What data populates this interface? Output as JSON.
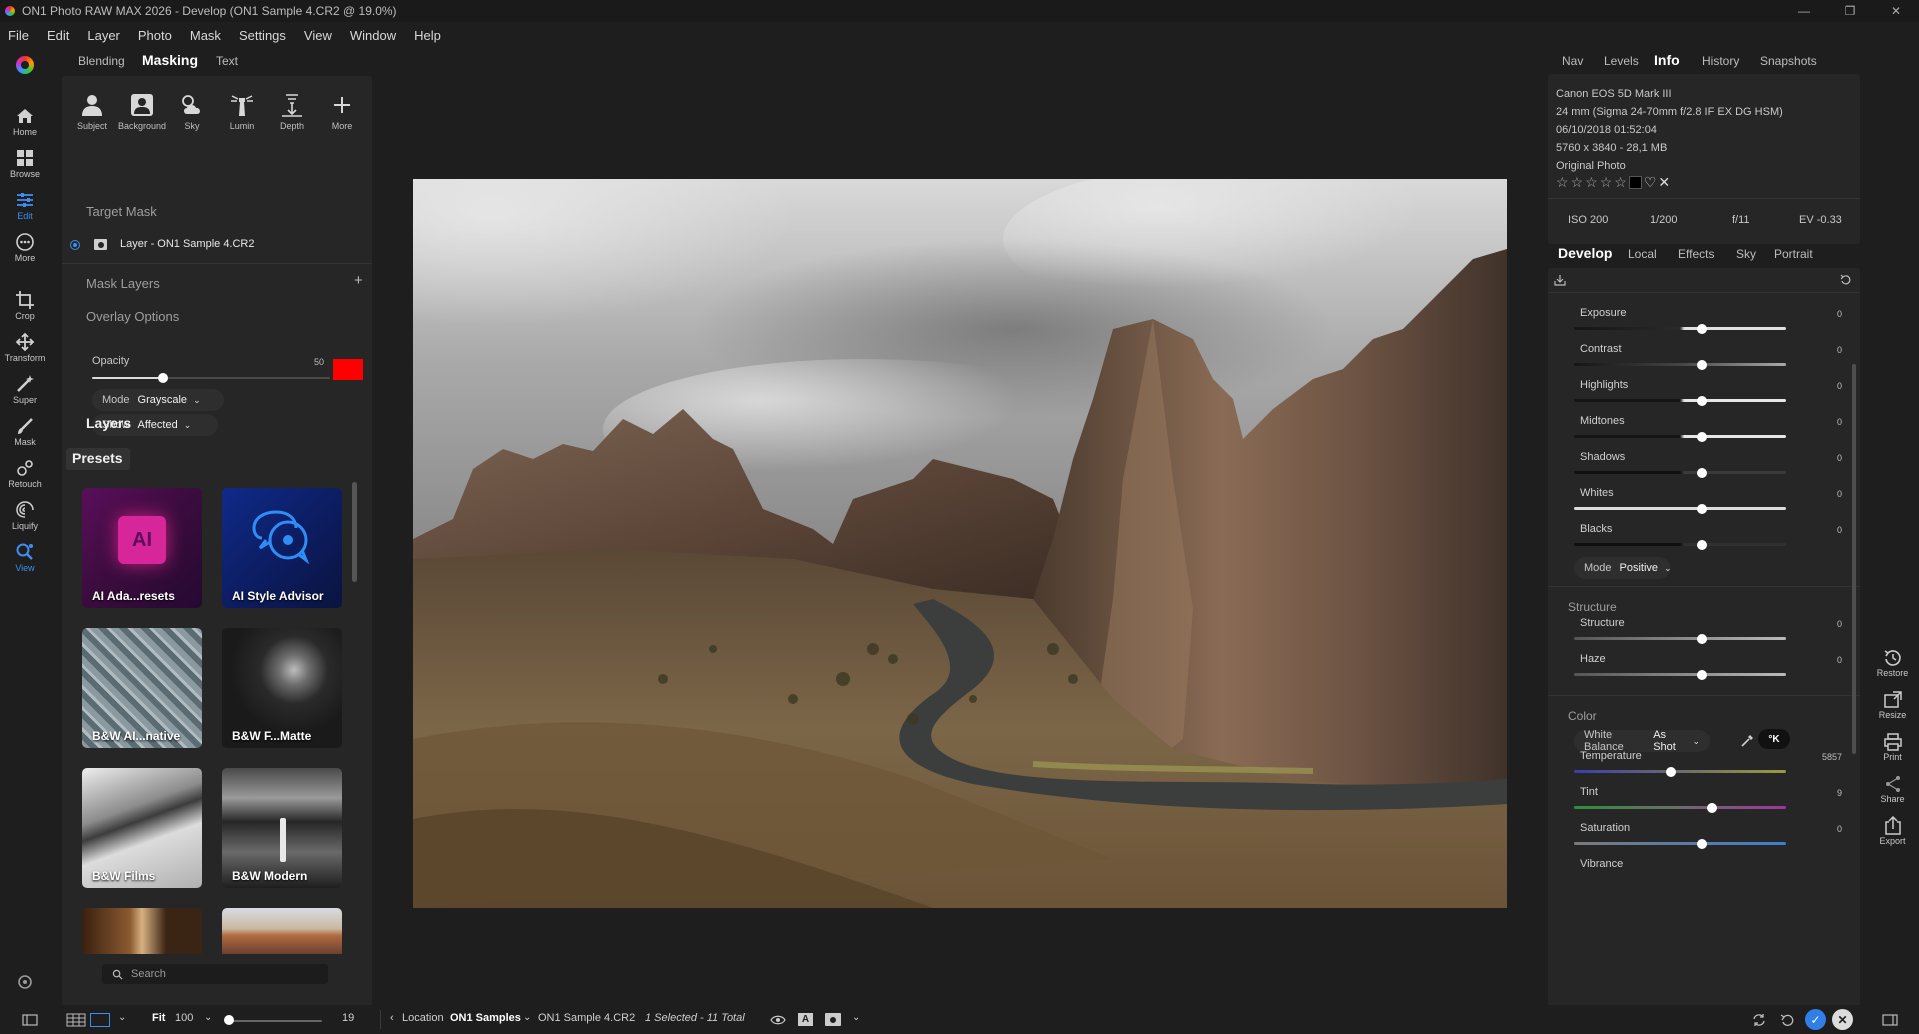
{
  "window": {
    "title": "ON1 Photo RAW MAX 2026 - Develop (ON1 Sample 4.CR2 @ 19.0%)",
    "controls": [
      "—",
      "❐",
      "✕"
    ]
  },
  "menu": [
    "File",
    "Edit",
    "Layer",
    "Photo",
    "Mask",
    "Settings",
    "View",
    "Window",
    "Help"
  ],
  "rail": [
    {
      "label": "Home",
      "icon": "home-icon"
    },
    {
      "label": "Browse",
      "icon": "grid-icon"
    },
    {
      "label": "Edit",
      "icon": "sliders-icon",
      "active": true
    },
    {
      "label": "More",
      "icon": "more-icon"
    },
    {
      "label": "Crop",
      "icon": "crop-icon"
    },
    {
      "label": "Transform",
      "icon": "move-icon"
    },
    {
      "label": "Super",
      "icon": "wand-icon"
    },
    {
      "label": "Mask",
      "icon": "brush-icon"
    },
    {
      "label": "Retouch",
      "icon": "retouch-icon"
    },
    {
      "label": "Liquify",
      "icon": "liquify-icon"
    },
    {
      "label": "View",
      "icon": "view-icon",
      "active": true
    }
  ],
  "leftpanel": {
    "tabs": [
      "Blending",
      "Masking",
      "Text"
    ],
    "active_tab": "Masking",
    "tools": [
      "Subject",
      "Background",
      "Sky",
      "Lumin",
      "Depth",
      "More"
    ],
    "target_mask_label": "Target Mask",
    "layer_name": "Layer - ON1 Sample 4.CR2",
    "mask_layers_label": "Mask Layers",
    "overlay_options_label": "Overlay Options",
    "opacity_label": "Opacity",
    "opacity_value": "50",
    "opacity_fraction": 0.3,
    "overlay_color": "#ff0000",
    "mode_key": "Mode",
    "mode_value": "Grayscale",
    "show_key": "Show",
    "show_value": "Affected",
    "layers_label": "Layers",
    "presets_label": "Presets",
    "presets": [
      "AI Ada...resets",
      "AI Style Advisor",
      "B&W AI...native",
      "B&W F...Matte",
      "B&W Films",
      "B&W Modern"
    ],
    "search_placeholder": "Search"
  },
  "rightpanel": {
    "top_tabs": [
      "Nav",
      "Levels",
      "Info",
      "History",
      "Snapshots"
    ],
    "active_top_tab": "Info",
    "info": {
      "camera": "Canon EOS 5D Mark III",
      "lens": "24 mm (Sigma 24-70mm f/2.8 IF EX DG HSM)",
      "datetime": "06/10/2018 01:52:04",
      "size": "5760 x 3840 - 28,1 MB",
      "original": "Original Photo",
      "iso": "ISO 200",
      "shutter": "1/200",
      "aperture": "f/11",
      "ev": "EV -0.33"
    },
    "develop_tabs": [
      "Develop",
      "Local",
      "Effects",
      "Sky",
      "Portrait"
    ],
    "active_develop_tab": "Develop",
    "tone": [
      {
        "label": "Exposure",
        "value": "0"
      },
      {
        "label": "Contrast",
        "value": "0"
      },
      {
        "label": "Highlights",
        "value": "0"
      },
      {
        "label": "Midtones",
        "value": "0"
      },
      {
        "label": "Shadows",
        "value": "0"
      },
      {
        "label": "Whites",
        "value": "0"
      },
      {
        "label": "Blacks",
        "value": "0"
      }
    ],
    "tone_mode_key": "Mode",
    "tone_mode_value": "Positive",
    "structure_header": "Structure",
    "structure": [
      {
        "label": "Structure",
        "value": "0"
      },
      {
        "label": "Haze",
        "value": "0"
      }
    ],
    "color_header": "Color",
    "wb_key": "White Balance",
    "wb_value": "As Shot",
    "wb_unit": "°K",
    "color": [
      {
        "label": "Temperature",
        "value": "5857"
      },
      {
        "label": "Tint",
        "value": "9"
      },
      {
        "label": "Saturation",
        "value": "0"
      },
      {
        "label": "Vibrance",
        "value": ""
      }
    ]
  },
  "rrail": [
    "Restore",
    "Resize",
    "Print",
    "Share",
    "Export"
  ],
  "bottombar": {
    "fit_label": "Fit",
    "zoom_value": "100",
    "size_value": "19",
    "location_key": "Location",
    "location_value": "ON1 Samples",
    "filename": "ON1 Sample 4.CR2",
    "selection": "1 Selected - 11 Total"
  }
}
